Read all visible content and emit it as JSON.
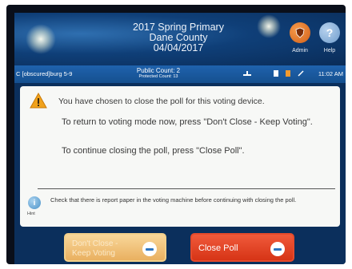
{
  "header": {
    "election_name": "2017 Spring Primary",
    "county": "Dane County",
    "date": "04/04/2017",
    "admin_label": "Admin",
    "help_label": "Help",
    "help_glyph": "?"
  },
  "statusbar": {
    "precinct": "C [obscured]burg 5-9",
    "public_count": "Public Count: 2",
    "protected_count": "Protected Count: 13",
    "time": "11:02 AM",
    "icons": [
      "network-icon",
      "document-icon",
      "battery-icon",
      "power-plug-icon"
    ]
  },
  "dialog": {
    "message": "You have chosen to close the poll for this voting device.",
    "return_instruction": "To return to voting mode now, press \"Don't Close - Keep Voting\".",
    "continue_instruction": "To continue closing the poll, press \"Close Poll\".",
    "hint_label": "Hint",
    "hint_glyph": "i",
    "hint_text": "Check that there is report paper in the voting machine before continuing with closing the poll."
  },
  "buttons": {
    "keep_voting_line1": "Don't Close -",
    "keep_voting_line2": "Keep Voting",
    "close_poll": "Close Poll"
  },
  "colors": {
    "header_blue": "#0f3f78",
    "statusbar_blue": "#1f62ad",
    "keep_button": "#e9b060",
    "close_button": "#d63416",
    "admin_orange": "#d0601a"
  }
}
